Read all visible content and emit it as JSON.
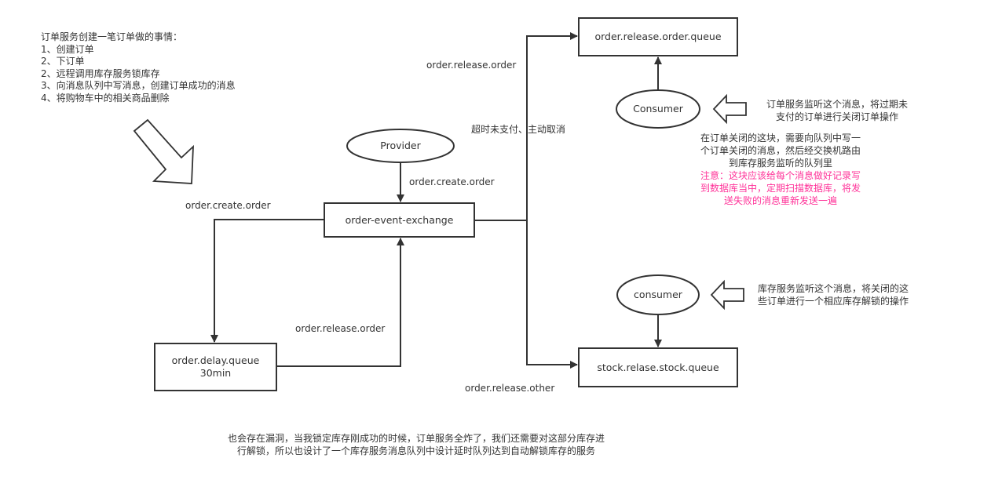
{
  "colors": {
    "line": "#333333",
    "text": "#333333",
    "warning": "#ff3399",
    "background": "#ffffff"
  },
  "order_steps_note": {
    "title": "订单服务创建一笔订单做的事情：",
    "items": [
      "1、创建订单",
      "2、下订单",
      "2、远程调用库存服务锁库存",
      "3、向消息队列中写消息，创建订单成功的消息",
      "4、将购物车中的相关商品删除"
    ]
  },
  "nodes": {
    "provider": "Provider",
    "exchange": "order-event-exchange",
    "delay_queue": {
      "line1": "order.delay.queue",
      "line2": "30min"
    },
    "release_order_queue": "order.release.order.queue",
    "stock_queue": "stock.relase.stock.queue",
    "consumer_order": "Consumer",
    "consumer_stock": "consumer"
  },
  "edge_labels": {
    "provider_to_exchange": "order.create.order",
    "exchange_to_delay": "order.create.order",
    "delay_to_exchange": "order.release.order",
    "exchange_to_release_queue": "order.release.order",
    "timeout_cancel": "超时未支付、主动取消",
    "exchange_to_stock_queue": "order.release.other"
  },
  "annotations": {
    "order_consumer_note": [
      "订单服务监听这个消息，将过期未",
      "支付的订单进行关闭订单操作"
    ],
    "close_order_note": [
      "在订单关闭的这块，需要向队列中写一",
      "个订单关闭的消息，然后经交换机路由",
      "到库存服务监听的队列里"
    ],
    "warning_note": [
      "注意：这块应该给每个消息做好记录写",
      "到数据库当中，定期扫描数据库，将发",
      "送失败的消息重新发送一遍"
    ],
    "stock_consumer_note": [
      "库存服务监听这个消息，将关闭的这",
      "些订单进行一个相应库存解锁的操作"
    ],
    "bottom_note": [
      "也会存在漏洞，当我锁定库存刚成功的时候，订单服务全炸了，我们还需要对这部分库存进",
      "行解锁，所以也设计了一个库存服务消息队列中设计延时队列达到自动解锁库存的服务"
    ]
  }
}
